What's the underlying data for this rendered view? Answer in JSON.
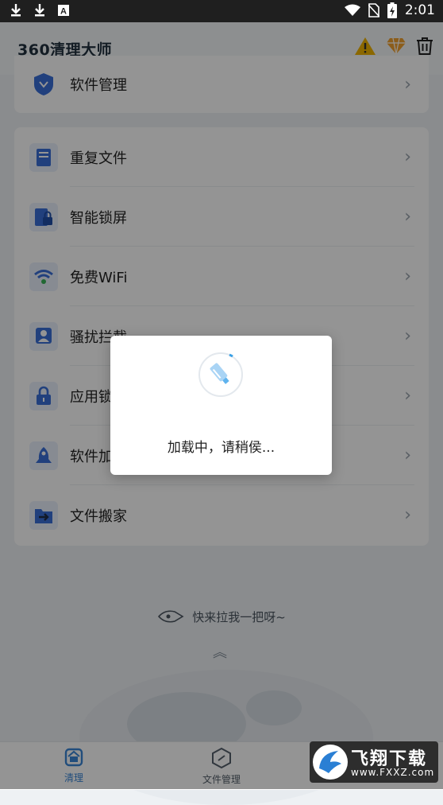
{
  "status_bar": {
    "time": "2:01",
    "left_icons": [
      "download-icon",
      "download-icon",
      "a-notification-icon"
    ],
    "right_icons": [
      "wifi-icon",
      "no-sim-icon",
      "battery-charging-icon"
    ]
  },
  "header": {
    "title": "360清理大师",
    "icons": [
      "warning-icon",
      "vip-diamond-icon",
      "trash-icon"
    ]
  },
  "top_card": {
    "label": "软件管理",
    "icon": "shield-icon"
  },
  "main_list": [
    {
      "label": "重复文件",
      "icon": "duplicate-file-icon"
    },
    {
      "label": "智能锁屏",
      "icon": "lock-screen-icon"
    },
    {
      "label": "免费WiFi",
      "icon": "wifi-icon"
    },
    {
      "label": "骚扰拦截",
      "icon": "block-user-icon"
    },
    {
      "label": "应用锁",
      "icon": "app-lock-icon"
    },
    {
      "label": "软件加速",
      "icon": "rocket-icon"
    },
    {
      "label": "文件搬家",
      "icon": "file-move-icon"
    }
  ],
  "pull_hint": "快来拉我一把呀~",
  "dialog": {
    "message": "加载中，请稍侯..."
  },
  "bottom_nav": [
    {
      "label": "清理",
      "icon": "clean-home-icon",
      "active": true
    },
    {
      "label": "文件管理",
      "icon": "file-manager-icon",
      "active": false
    },
    {
      "label": "",
      "icon": "more-icon",
      "active": false
    }
  ],
  "watermark": {
    "title": "飞翔下载",
    "url": "www.FXXZ.com"
  },
  "colors": {
    "accent": "#3a86d6",
    "overlay": "#000000",
    "warning": "#f0b400",
    "vip": "#f0a030"
  }
}
